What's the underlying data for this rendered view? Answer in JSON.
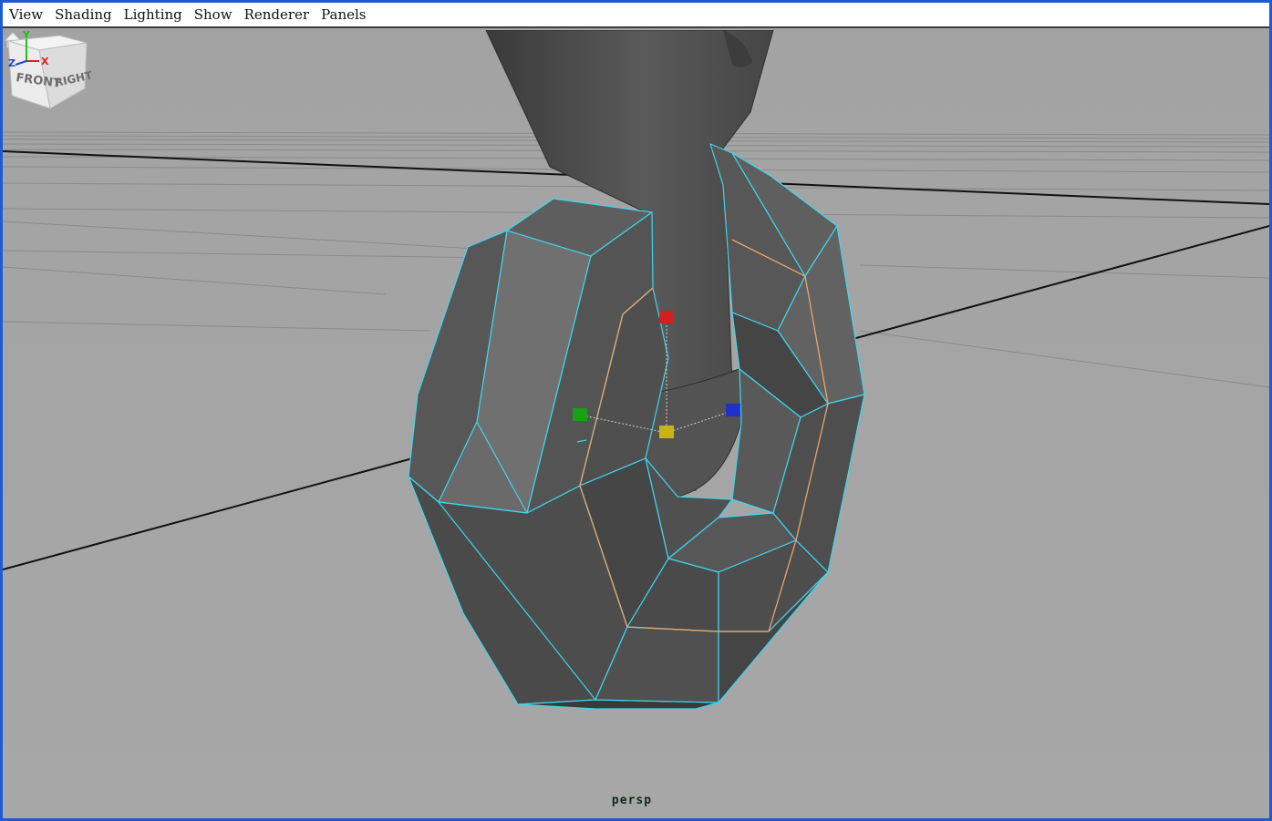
{
  "menubar": {
    "items": [
      {
        "label": "View"
      },
      {
        "label": "Shading"
      },
      {
        "label": "Lighting"
      },
      {
        "label": "Show"
      },
      {
        "label": "Renderer"
      },
      {
        "label": "Panels"
      }
    ]
  },
  "viewport": {
    "camera": "persp",
    "background_color": "#a5a5a5",
    "selection_edge_color": "#3fd6f0",
    "loop_edge_color": "#e8a46a",
    "mesh_color": "#4b4b4b"
  },
  "view_cube": {
    "front_label": "FRONT",
    "right_label": "RIGHT",
    "home_icon": "home-icon"
  },
  "axis_gizmo": {
    "x_label": "X",
    "y_label": "Y",
    "z_label": "Z",
    "x_color": "#e02020",
    "y_color": "#1fbf1f",
    "z_color": "#2540e0"
  },
  "manipulator": {
    "handle_colors": {
      "x": "#d02020",
      "y": "#19a019",
      "z": "#2030c8",
      "center": "#c8b418"
    }
  }
}
